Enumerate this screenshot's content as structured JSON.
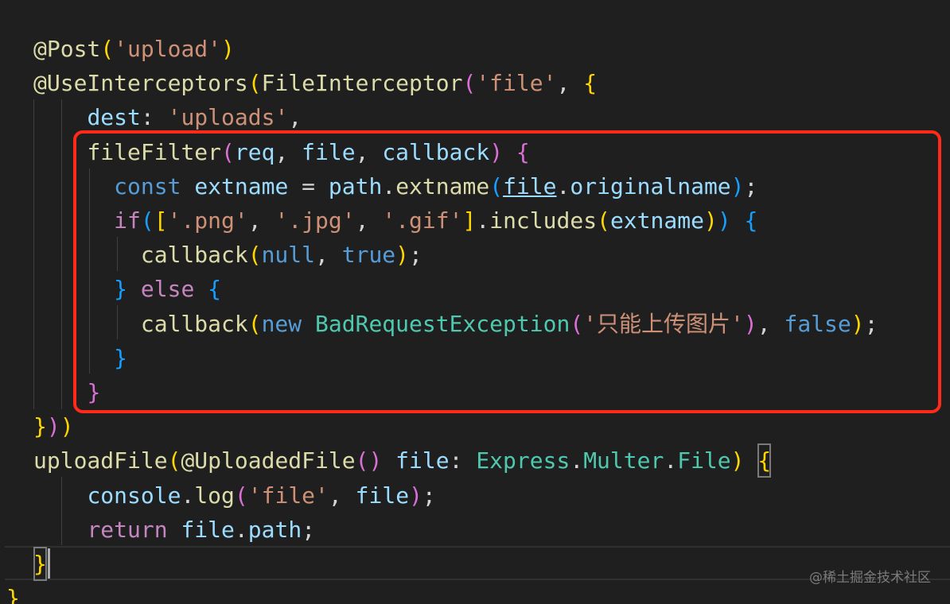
{
  "colors": {
    "background": "#1f1f1f",
    "default": "#d4d4d4",
    "keyword_blue": "#569cd6",
    "keyword_purple": "#c586c0",
    "function": "#dcdcaa",
    "string": "#ce9178",
    "property": "#9cdcfe",
    "type": "#4ec9b0",
    "bracket_gold": "#ffd700",
    "bracket_pink": "#da70d6",
    "bracket_blue": "#179fff",
    "highlight_border": "#ff2a1a"
  },
  "code": {
    "lines": [
      [
        [
          "@Post",
          "function"
        ],
        [
          "(",
          "bracket_gold"
        ],
        [
          "'upload'",
          "string"
        ],
        [
          ")",
          "bracket_gold"
        ]
      ],
      [
        [
          "@UseInterceptors",
          "function"
        ],
        [
          "(",
          "bracket_gold"
        ],
        [
          "FileInterceptor",
          "function"
        ],
        [
          "(",
          "bracket_pink"
        ],
        [
          "'file'",
          "string"
        ],
        [
          ", ",
          "default"
        ],
        [
          "{",
          "bracket_gold"
        ]
      ],
      [
        [
          "    ",
          "default"
        ],
        [
          "dest",
          "property"
        ],
        [
          ": ",
          "default"
        ],
        [
          "'uploads'",
          "string"
        ],
        [
          ",",
          "default"
        ]
      ],
      [
        [
          "    ",
          "default"
        ],
        [
          "fileFilter",
          "function"
        ],
        [
          "(",
          "bracket_pink"
        ],
        [
          "req",
          "property"
        ],
        [
          ", ",
          "default"
        ],
        [
          "file",
          "property"
        ],
        [
          ", ",
          "default"
        ],
        [
          "callback",
          "property"
        ],
        [
          ")",
          "bracket_pink"
        ],
        [
          " ",
          "default"
        ],
        [
          "{",
          "bracket_pink"
        ]
      ],
      [
        [
          "      ",
          "default"
        ],
        [
          "const",
          "keyword_blue"
        ],
        [
          " ",
          "default"
        ],
        [
          "extname",
          "property"
        ],
        [
          " = ",
          "default"
        ],
        [
          "path",
          "property"
        ],
        [
          ".",
          "default"
        ],
        [
          "extname",
          "function"
        ],
        [
          "(",
          "bracket_blue"
        ],
        [
          "file",
          "property",
          "underline"
        ],
        [
          ".",
          "default"
        ],
        [
          "originalname",
          "property"
        ],
        [
          ")",
          "bracket_blue"
        ],
        [
          ";",
          "default"
        ]
      ],
      [
        [
          "      ",
          "default"
        ],
        [
          "if",
          "keyword_purple"
        ],
        [
          "(",
          "bracket_blue"
        ],
        [
          "[",
          "bracket_gold"
        ],
        [
          "'.png'",
          "string"
        ],
        [
          ", ",
          "default"
        ],
        [
          "'.jpg'",
          "string"
        ],
        [
          ", ",
          "default"
        ],
        [
          "'.gif'",
          "string"
        ],
        [
          "]",
          "bracket_gold"
        ],
        [
          ".",
          "default"
        ],
        [
          "includes",
          "function"
        ],
        [
          "(",
          "bracket_gold"
        ],
        [
          "extname",
          "property"
        ],
        [
          ")",
          "bracket_gold"
        ],
        [
          ")",
          "bracket_blue"
        ],
        [
          " ",
          "default"
        ],
        [
          "{",
          "bracket_blue"
        ]
      ],
      [
        [
          "        ",
          "default"
        ],
        [
          "callback",
          "function"
        ],
        [
          "(",
          "bracket_gold"
        ],
        [
          "null",
          "keyword_blue"
        ],
        [
          ", ",
          "default"
        ],
        [
          "true",
          "keyword_blue"
        ],
        [
          ")",
          "bracket_gold"
        ],
        [
          ";",
          "default"
        ]
      ],
      [
        [
          "      ",
          "default"
        ],
        [
          "}",
          "bracket_blue"
        ],
        [
          " ",
          "default"
        ],
        [
          "else",
          "keyword_purple"
        ],
        [
          " ",
          "default"
        ],
        [
          "{",
          "bracket_blue"
        ]
      ],
      [
        [
          "        ",
          "default"
        ],
        [
          "callback",
          "function"
        ],
        [
          "(",
          "bracket_gold"
        ],
        [
          "new",
          "keyword_blue"
        ],
        [
          " ",
          "default"
        ],
        [
          "BadRequestException",
          "type"
        ],
        [
          "(",
          "bracket_pink"
        ],
        [
          "'只能上传图片'",
          "string"
        ],
        [
          ")",
          "bracket_pink"
        ],
        [
          ", ",
          "default"
        ],
        [
          "false",
          "keyword_blue"
        ],
        [
          ")",
          "bracket_gold"
        ],
        [
          ";",
          "default"
        ]
      ],
      [
        [
          "      ",
          "default"
        ],
        [
          "}",
          "bracket_blue"
        ]
      ],
      [
        [
          "    ",
          "default"
        ],
        [
          "}",
          "bracket_pink"
        ]
      ],
      [
        [
          "}",
          "bracket_gold"
        ],
        [
          ")",
          "bracket_pink"
        ],
        [
          ")",
          "bracket_gold"
        ]
      ],
      [
        [
          "uploadFile",
          "function"
        ],
        [
          "(",
          "bracket_gold"
        ],
        [
          "@UploadedFile",
          "function"
        ],
        [
          "(",
          "bracket_pink"
        ],
        [
          ")",
          "bracket_pink"
        ],
        [
          " ",
          "default"
        ],
        [
          "file",
          "property"
        ],
        [
          ": ",
          "default"
        ],
        [
          "Express",
          "type"
        ],
        [
          ".",
          "default"
        ],
        [
          "Multer",
          "type"
        ],
        [
          ".",
          "default"
        ],
        [
          "File",
          "type"
        ],
        [
          ")",
          "bracket_gold"
        ],
        [
          " ",
          "default"
        ],
        [
          "{",
          "bracket_gold",
          "match"
        ]
      ],
      [
        [
          "    ",
          "default"
        ],
        [
          "console",
          "property"
        ],
        [
          ".",
          "default"
        ],
        [
          "log",
          "function"
        ],
        [
          "(",
          "bracket_pink"
        ],
        [
          "'file'",
          "string"
        ],
        [
          ", ",
          "default"
        ],
        [
          "file",
          "property"
        ],
        [
          ")",
          "bracket_pink"
        ],
        [
          ";",
          "default"
        ]
      ],
      [
        [
          "    ",
          "default"
        ],
        [
          "return",
          "keyword_purple"
        ],
        [
          " ",
          "default"
        ],
        [
          "file",
          "property"
        ],
        [
          ".",
          "default"
        ],
        [
          "path",
          "property"
        ],
        [
          ";",
          "default"
        ]
      ],
      [
        [
          "}",
          "bracket_gold",
          "match"
        ]
      ]
    ],
    "tail_line": [
      [
        "}",
        "bracket_gold"
      ]
    ]
  },
  "watermark": "@稀土掘金技术社区"
}
